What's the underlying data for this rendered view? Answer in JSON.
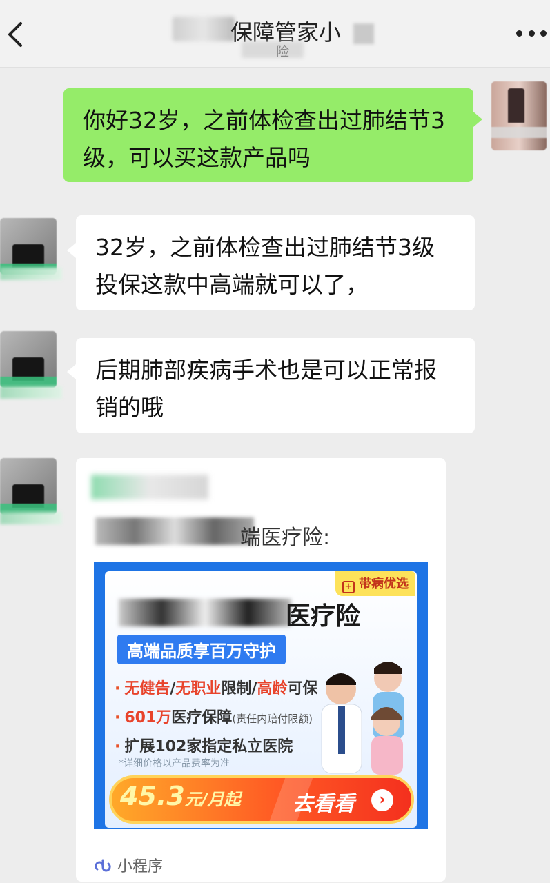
{
  "header": {
    "title": "保障管家小",
    "subtitle": "险"
  },
  "messages": [
    {
      "from": "me",
      "text": "你好32岁，之前体检查出过肺结节3级，可以买这款产品吗"
    },
    {
      "from": "agent",
      "text": "32岁，之前体检查出过肺结节3级投保这款中高端就可以了，"
    },
    {
      "from": "agent",
      "text": "后期肺部疾病手术也是可以正常报销的哦"
    }
  ],
  "card": {
    "title": "端医疗险:",
    "poster": {
      "badge": "带病优选",
      "product_title": "医疗险",
      "subhead": "高端品质享百万守护",
      "bullet1": {
        "a": "无健告",
        "b": "/",
        "c": "无职业",
        "d": "限制/",
        "e": "高龄",
        "f": "可保"
      },
      "bullet2": {
        "a": "601万",
        "b": "医疗保障",
        "c": "(责任内赔付限额)"
      },
      "bullet3": "扩展102家指定私立医院",
      "note": "*详细价格以产品费率为准",
      "price": "45.3",
      "price_unit": "元/月起",
      "cta": "去看看"
    },
    "source_label": "小程序"
  },
  "colors": {
    "sent_bubble": "#95ec69",
    "received_bubble": "#ffffff",
    "background": "#ededed",
    "poster_blue": "#1e74e5",
    "cta_orange": "#ff5a24"
  }
}
